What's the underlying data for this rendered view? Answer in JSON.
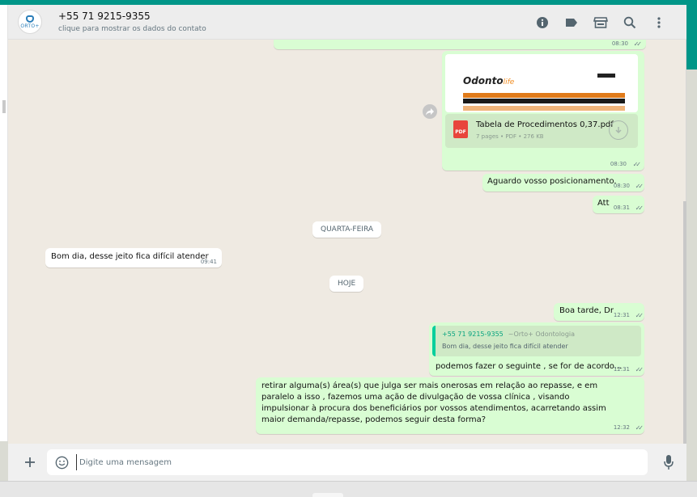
{
  "header": {
    "avatar_label": "ORTO+",
    "contact_name": "+55 71 9215-9355",
    "contact_sub": "clique para mostrar os dados do contato",
    "icons": [
      "info-icon",
      "label-icon",
      "store-icon",
      "search-icon",
      "menu-icon"
    ]
  },
  "chat": {
    "top_partial_time": "08:30",
    "pdf": {
      "preview_logo": "Odonto",
      "preview_logo_suffix": "life",
      "badge": "PDF",
      "name": "Tabela de Procedimentos 0,37.pdf",
      "info": "7 pages • PDF • 276 KB",
      "time": "08:30"
    },
    "messages": [
      {
        "text": "Aguardo vosso posicionamento.",
        "time": "08:30"
      },
      {
        "text": "Att",
        "time": "08:31"
      },
      {
        "text": "Bom dia, desse jeito fica difícil atender",
        "time": "09:41"
      },
      {
        "text": "Boa tarde, Dr",
        "time": "12:31"
      },
      {
        "text": "podemos fazer o seguinte , se for de acordo...",
        "time": "12:31"
      },
      {
        "text": "retirar alguma(s) área(s) que julga ser mais onerosas em relação ao repasse, e em paralelo a isso , fazemos uma ação de divulgação de vossa clínica , visando impulsionar à procura dos beneficiários por vossos atendimentos, acarretando assim maior demanda/repasse, podemos seguir desta forma?",
        "time": "12:32"
      }
    ],
    "day_chips": [
      "QUARTA-FEIRA",
      "HOJE"
    ],
    "quote": {
      "name": "+55 71 9215-9355",
      "pushname": "~Orto+ Odontologia",
      "text": "Bom dia, desse jeito fica difícil atender"
    }
  },
  "footer": {
    "placeholder": "Digite uma mensagem"
  },
  "colors": {
    "accent": "#009688",
    "outgoing": "#d9fdd3",
    "incoming": "#ffffff",
    "chat_bg": "#efeae2",
    "pdf_red": "#e8453c"
  }
}
